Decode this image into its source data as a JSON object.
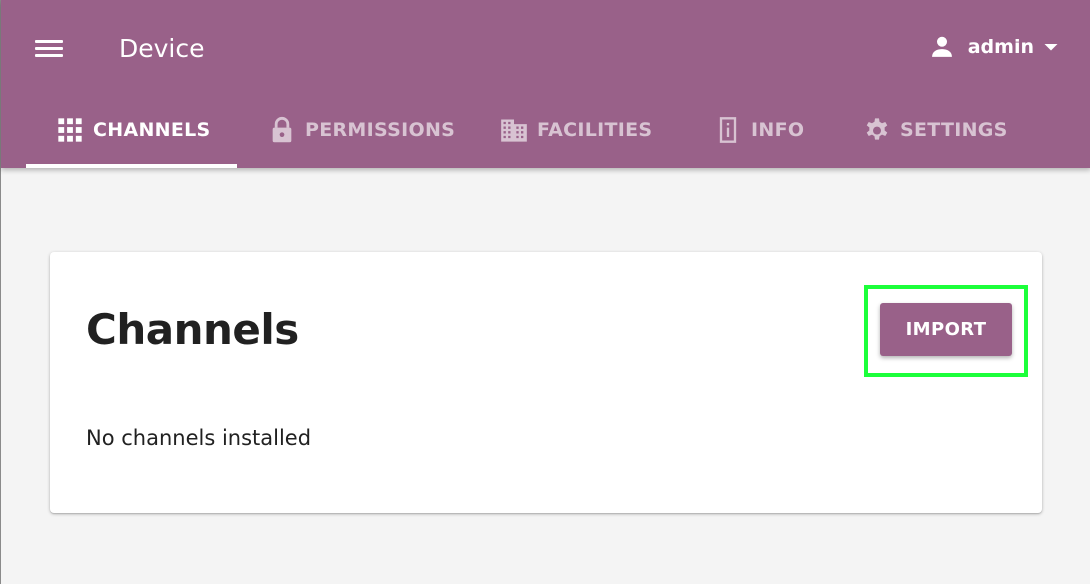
{
  "header": {
    "menu_icon": "hamburger-menu-icon",
    "title": "Device",
    "user": {
      "name": "admin",
      "icon": "person-icon",
      "dropdown_icon": "caret-down-icon"
    }
  },
  "tabs": [
    {
      "label": "CHANNELS",
      "icon": "grid-icon",
      "active": true
    },
    {
      "label": "PERMISSIONS",
      "icon": "lock-icon",
      "active": false
    },
    {
      "label": "FACILITIES",
      "icon": "building-icon",
      "active": false
    },
    {
      "label": "INFO",
      "icon": "device-info-icon",
      "active": false
    },
    {
      "label": "SETTINGS",
      "icon": "gear-icon",
      "active": false
    }
  ],
  "main": {
    "heading": "Channels",
    "import_label": "IMPORT",
    "empty_message": "No channels installed"
  },
  "colors": {
    "brand": "#996189",
    "highlight": "#1cff3a",
    "background": "#f4f4f4"
  }
}
